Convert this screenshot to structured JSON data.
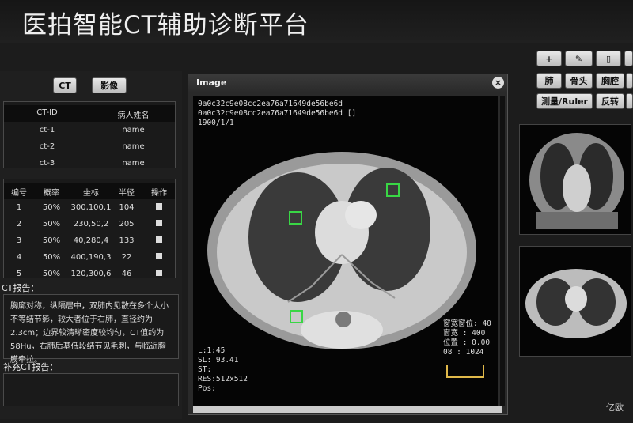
{
  "header": {
    "title": "医拍智能CT辅助诊断平台"
  },
  "left": {
    "tabs": {
      "ct": "CT",
      "image": "影像"
    },
    "ct_table": {
      "headers": [
        "CT-ID",
        "病人姓名"
      ],
      "rows": [
        [
          "ct-1",
          "name"
        ],
        [
          "ct-2",
          "name"
        ],
        [
          "ct-3",
          "name"
        ]
      ]
    },
    "nodule_table": {
      "headers": [
        "编号",
        "概率",
        "坐标",
        "半径",
        "操作"
      ],
      "rows": [
        [
          "1",
          "50%",
          "300,100,1",
          "104"
        ],
        [
          "2",
          "50%",
          "230,50,2",
          "205"
        ],
        [
          "3",
          "50%",
          "40,280,4",
          "133"
        ],
        [
          "4",
          "50%",
          "400,190,3",
          "22"
        ],
        [
          "5",
          "50%",
          "120,300,6",
          "46"
        ]
      ]
    },
    "report_label": "CT报告：",
    "report_text": "胸廓对称，纵隔居中，双肺内见散在多个大小不等结节影，较大者位于右肺，直径约为2.3cm；边界较清晰密度较均匀，CT值约为 58Hu，右肺后基低段结节见毛刺，与临近胸膜牵拉。",
    "supplement_label": "补充CT报告："
  },
  "toolbar": {
    "row1": [
      "+",
      "✎",
      "▯"
    ],
    "row2": [
      "肺",
      "骨头",
      "胸腔"
    ],
    "row3": [
      "测量/Ruler",
      "反转"
    ]
  },
  "viewer": {
    "title": "Image",
    "close": "×",
    "info_lines": [
      "0a0c32c9e08cc2ea76a71649de56be6d",
      "0a0c32c9e08cc2ea76a71649de56be6d []",
      "1900/1/1"
    ],
    "bottom_left": [
      "L:1:45",
      "SL: 93.41",
      "ST:",
      "RES:512x512",
      "Pos:"
    ],
    "bottom_right": [
      "窗宽窗位: 40",
      "窗宽 : 400",
      "位置 : 0.00",
      "08 : 1024"
    ]
  },
  "watermark": "亿欧"
}
